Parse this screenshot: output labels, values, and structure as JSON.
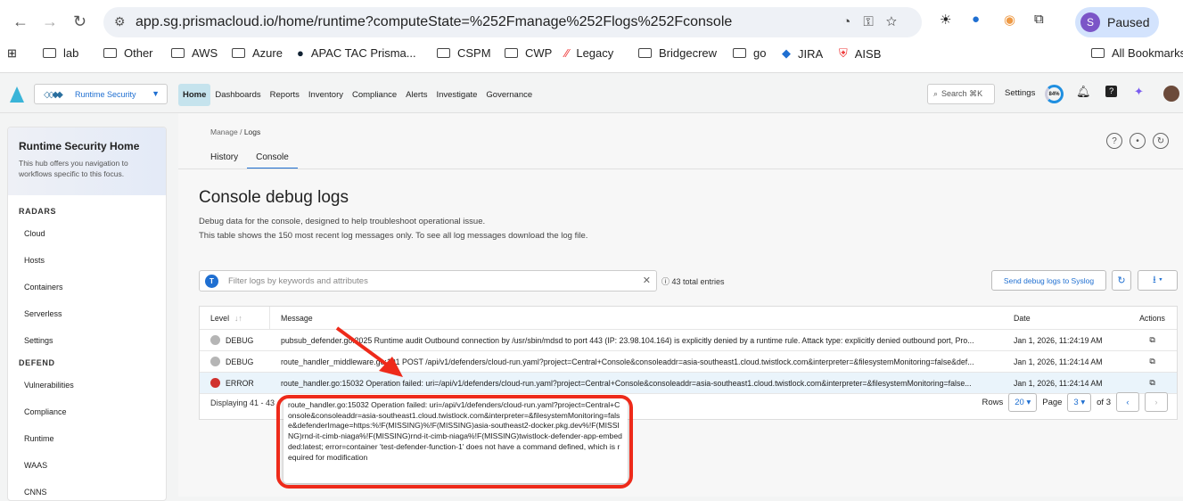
{
  "browser": {
    "url": "app.sg.prismacloud.io/home/runtime?computeState=%252Fmanage%252Flogs%252Fconsole",
    "profile_initial": "S",
    "profile_label": "Paused",
    "bookmarks": [
      "lab",
      "Other",
      "AWS",
      "Azure",
      "APAC TAC Prisma...",
      "CSPM",
      "CWP",
      "Legacy",
      "Bridgecrew",
      "go",
      "JIRA",
      "AISB"
    ],
    "all_bookmarks": "All Bookmarks"
  },
  "app": {
    "product": "Runtime Security",
    "nav": [
      "Home",
      "Dashboards",
      "Reports",
      "Inventory",
      "Compliance",
      "Alerts",
      "Investigate",
      "Governance"
    ],
    "search": "Search ⌘K",
    "settings": "Settings",
    "progress": "84%"
  },
  "sidebar": {
    "title": "Runtime Security Home",
    "subtitle": "This hub offers you navigation to workflows specific to this focus.",
    "sections": [
      {
        "label": "RADARS",
        "items": [
          "Cloud",
          "Hosts",
          "Containers",
          "Serverless",
          "Settings"
        ]
      },
      {
        "label": "DEFEND",
        "items": [
          "Vulnerabilities",
          "Compliance",
          "Runtime",
          "WAAS",
          "CNNS"
        ]
      }
    ]
  },
  "page": {
    "breadcrumb_parent": "Manage",
    "breadcrumb_current": "Logs",
    "tabs": [
      "History",
      "Console"
    ],
    "title": "Console debug logs",
    "desc1": "Debug data for the console, designed to help troubleshoot operational issue.",
    "desc2": "This table shows the 150 most recent log messages only. To see all log messages download the log file.",
    "filter_placeholder": "Filter logs by keywords and attributes",
    "total": "43 total entries",
    "syslog_button": "Send debug logs to Syslog"
  },
  "table": {
    "headers": [
      "Level",
      "Message",
      "Date",
      "Actions"
    ],
    "rows": [
      {
        "level": "DEBUG",
        "color": "#b5b5b5",
        "message": "pubsub_defender.go:2025 Runtime audit Outbound connection by /usr/sbin/mdsd to port 443 (IP: 23.98.104.164) is explicitly denied by a runtime rule. Attack type: explicitly denied outbound port, Pro...",
        "date": "Jan 1, 2026, 11:24:19 AM"
      },
      {
        "level": "DEBUG",
        "color": "#b5b5b5",
        "message": "route_handler_middleware.go:101 POST /api/v1/defenders/cloud-run.yaml?project=Central+Console&consoleaddr=asia-southeast1.cloud.twistlock.com&interpreter=&filesystemMonitoring=false&def...",
        "date": "Jan 1, 2026, 11:24:14 AM"
      },
      {
        "level": "ERROR",
        "color": "#d0312d",
        "message": "route_handler.go:15032 Operation failed: uri=/api/v1/defenders/cloud-run.yaml?project=Central+Console&consoleaddr=asia-southeast1.cloud.twistlock.com&interpreter=&filesystemMonitoring=false...",
        "date": "Jan 1, 2026, 11:24:14 AM"
      }
    ],
    "displaying": "Displaying 41 - 43",
    "rows_label": "Rows",
    "rows_value": "20",
    "page_label": "Page",
    "page_value": "3",
    "of": "of 3"
  },
  "tooltip": "route_handler.go:15032 Operation failed: uri=/api/v1/defenders/cloud-run.yaml?project=Central+Console&consoleaddr=asia-southeast1.cloud.twistlock.com&interpreter=&filesystemMonitoring=false&defenderImage=https:%!F(MISSING)%!F(MISSING)asia-southeast2-docker.pkg.dev%!F(MISSING)rnd-it-cimb-niaga%!F(MISSING)rnd-it-cimb-niaga%!F(MISSING)twistlock-defender-app-embedded:latest; error=container 'test-defender-function-1' does not have a command defined, which is required for modification"
}
